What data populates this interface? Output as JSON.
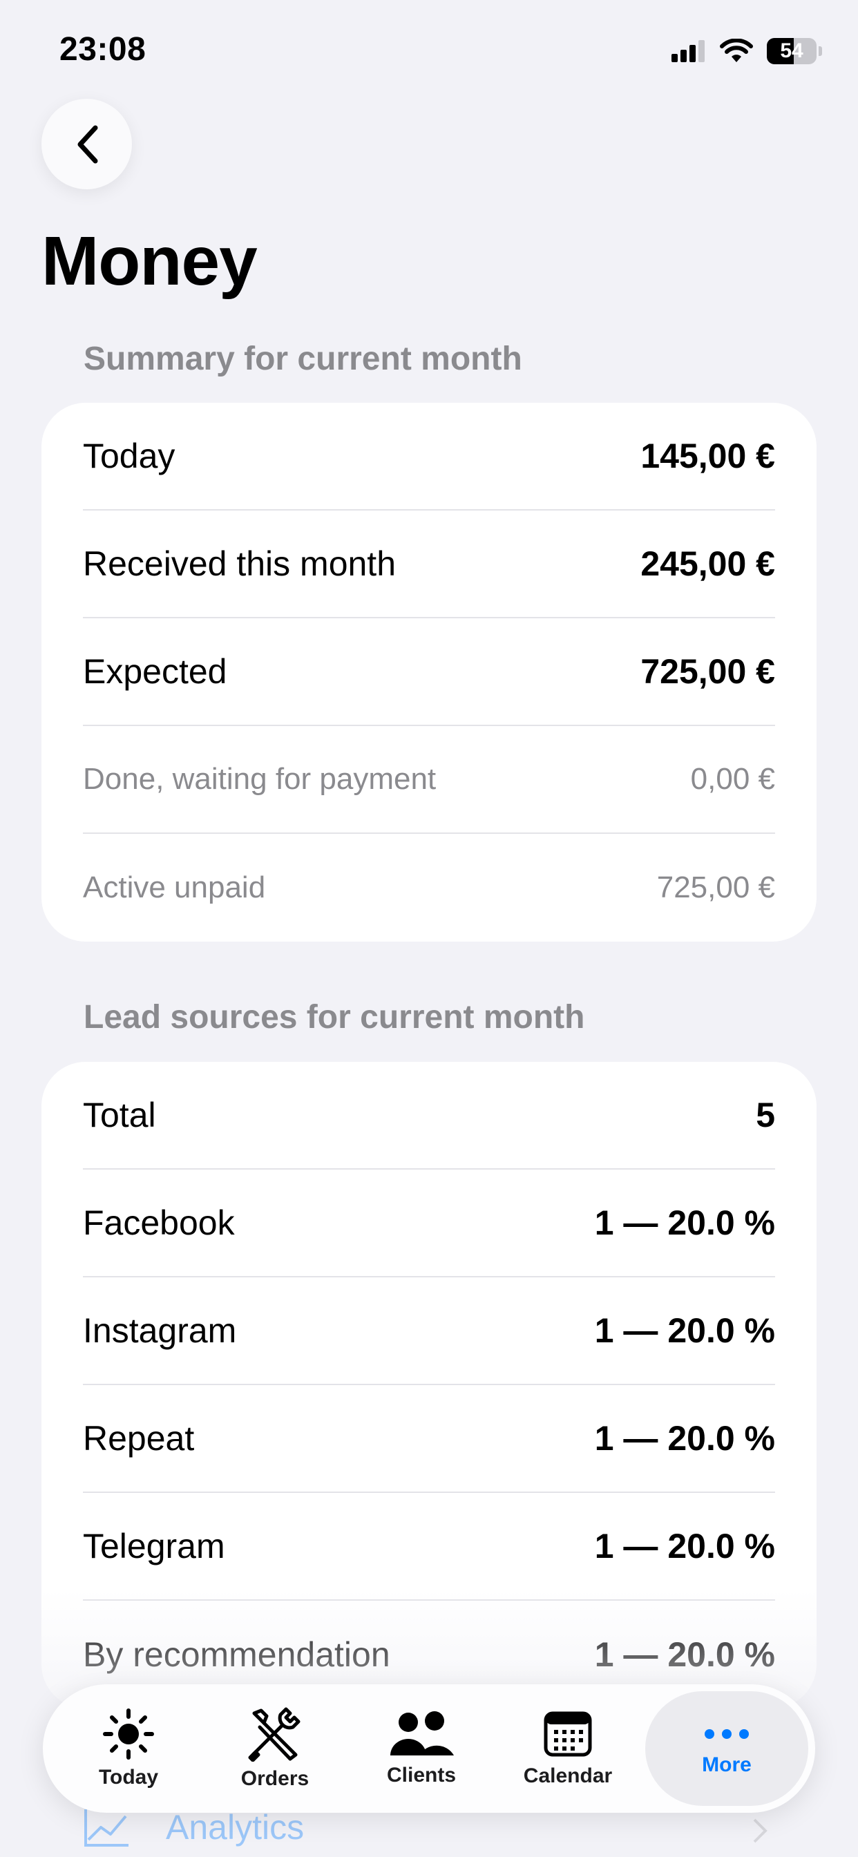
{
  "status_bar": {
    "time": "23:08",
    "battery": "54"
  },
  "page": {
    "title": "Money"
  },
  "summary": {
    "header": "Summary for current month",
    "rows": [
      {
        "label": "Today",
        "value": "145,00 €"
      },
      {
        "label": "Received this month",
        "value": "245,00 €"
      },
      {
        "label": "Expected",
        "value": "725,00 €"
      },
      {
        "label": "Done, waiting for payment",
        "value": "0,00 €"
      },
      {
        "label": "Active unpaid",
        "value": "725,00 €"
      }
    ]
  },
  "lead_sources": {
    "header": "Lead sources for current month",
    "rows": [
      {
        "label": "Total",
        "value": "5"
      },
      {
        "label": "Facebook",
        "value": "1 — 20.0 %"
      },
      {
        "label": "Instagram",
        "value": "1 — 20.0 %"
      },
      {
        "label": "Repeat",
        "value": "1 — 20.0 %"
      },
      {
        "label": "Telegram",
        "value": "1 — 20.0 %"
      },
      {
        "label": "By recommendation",
        "value": "1 — 20.0 %"
      }
    ]
  },
  "peek_item": {
    "label": "Analytics",
    "icon": "chart-line-icon"
  },
  "tab_bar": {
    "items": [
      {
        "label": "Today",
        "icon": "sun-icon"
      },
      {
        "label": "Orders",
        "icon": "tools-icon"
      },
      {
        "label": "Clients",
        "icon": "people-icon"
      },
      {
        "label": "Calendar",
        "icon": "calendar-icon"
      },
      {
        "label": "More",
        "icon": "ellipsis-icon",
        "active": true
      }
    ]
  },
  "colors": {
    "accent": "#007aff",
    "background": "#f2f2f7",
    "secondary_text": "#8a8a8e"
  }
}
